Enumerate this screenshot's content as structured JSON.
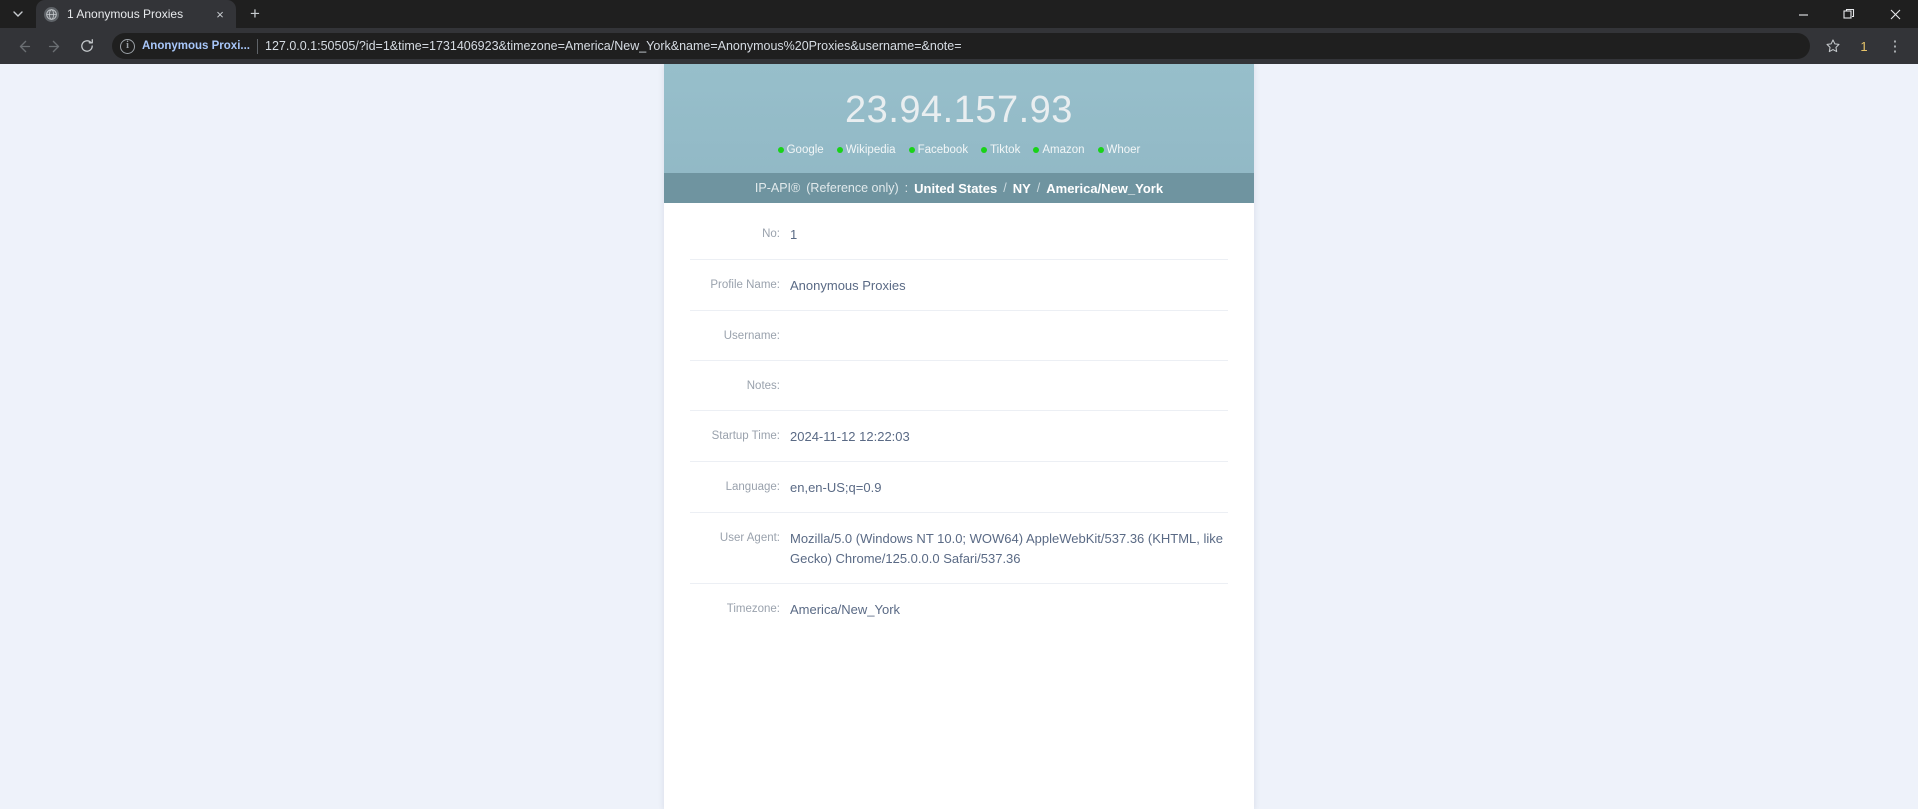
{
  "browser": {
    "tab": {
      "title": "1 Anonymous Proxies",
      "favicon": "globe-icon",
      "close": "×"
    },
    "new_tab_label": "+",
    "tab_list_caret": "⌄",
    "window_controls": {
      "minimize": "—",
      "maximize": "❐",
      "close": "✕"
    },
    "nav": {
      "back": "←",
      "forward": "→",
      "reload": "⟳"
    },
    "omnibox": {
      "info_icon": "i",
      "site_chip": "Anonymous Proxi...",
      "url": "127.0.0.1:50505/?id=1&time=1731406923&timezone=America/New_York&name=Anonymous%20Proxies&username=&note=",
      "bookmark_icon": "☆"
    },
    "profile_badge": "1",
    "menu_icon": "⋮"
  },
  "page": {
    "hero": {
      "ip": "23.94.157.93",
      "links": [
        "Google",
        "Wikipedia",
        "Facebook",
        "Tiktok",
        "Amazon",
        "Whoer"
      ]
    },
    "geo": {
      "source": "IP-API®",
      "note": "(Reference only)",
      "colon": ":",
      "country": "United States",
      "region": "NY",
      "timezone": "America/New_York",
      "separator": "/"
    },
    "fields": [
      {
        "label": "No:",
        "value": "1"
      },
      {
        "label": "Profile Name:",
        "value": "Anonymous Proxies"
      },
      {
        "label": "Username:",
        "value": ""
      },
      {
        "label": "Notes:",
        "value": ""
      },
      {
        "label": "Startup Time:",
        "value": "2024-11-12 12:22:03"
      },
      {
        "label": "Language:",
        "value": "en,en-US;q=0.9"
      },
      {
        "label": "User Agent:",
        "value": "Mozilla/5.0 (Windows NT 10.0; WOW64) AppleWebKit/537.36 (KHTML, like Gecko) Chrome/125.0.0.0 Safari/537.36"
      },
      {
        "label": "Timezone:",
        "value": "America/New_York"
      }
    ]
  },
  "colors": {
    "hero_bg": "#92b9c6",
    "geo_bg": "#6f94a0",
    "dot_green": "#18d318",
    "value_text": "#5a6a85",
    "label_text": "#9aa2ad",
    "page_bg": "#eef2fa"
  }
}
